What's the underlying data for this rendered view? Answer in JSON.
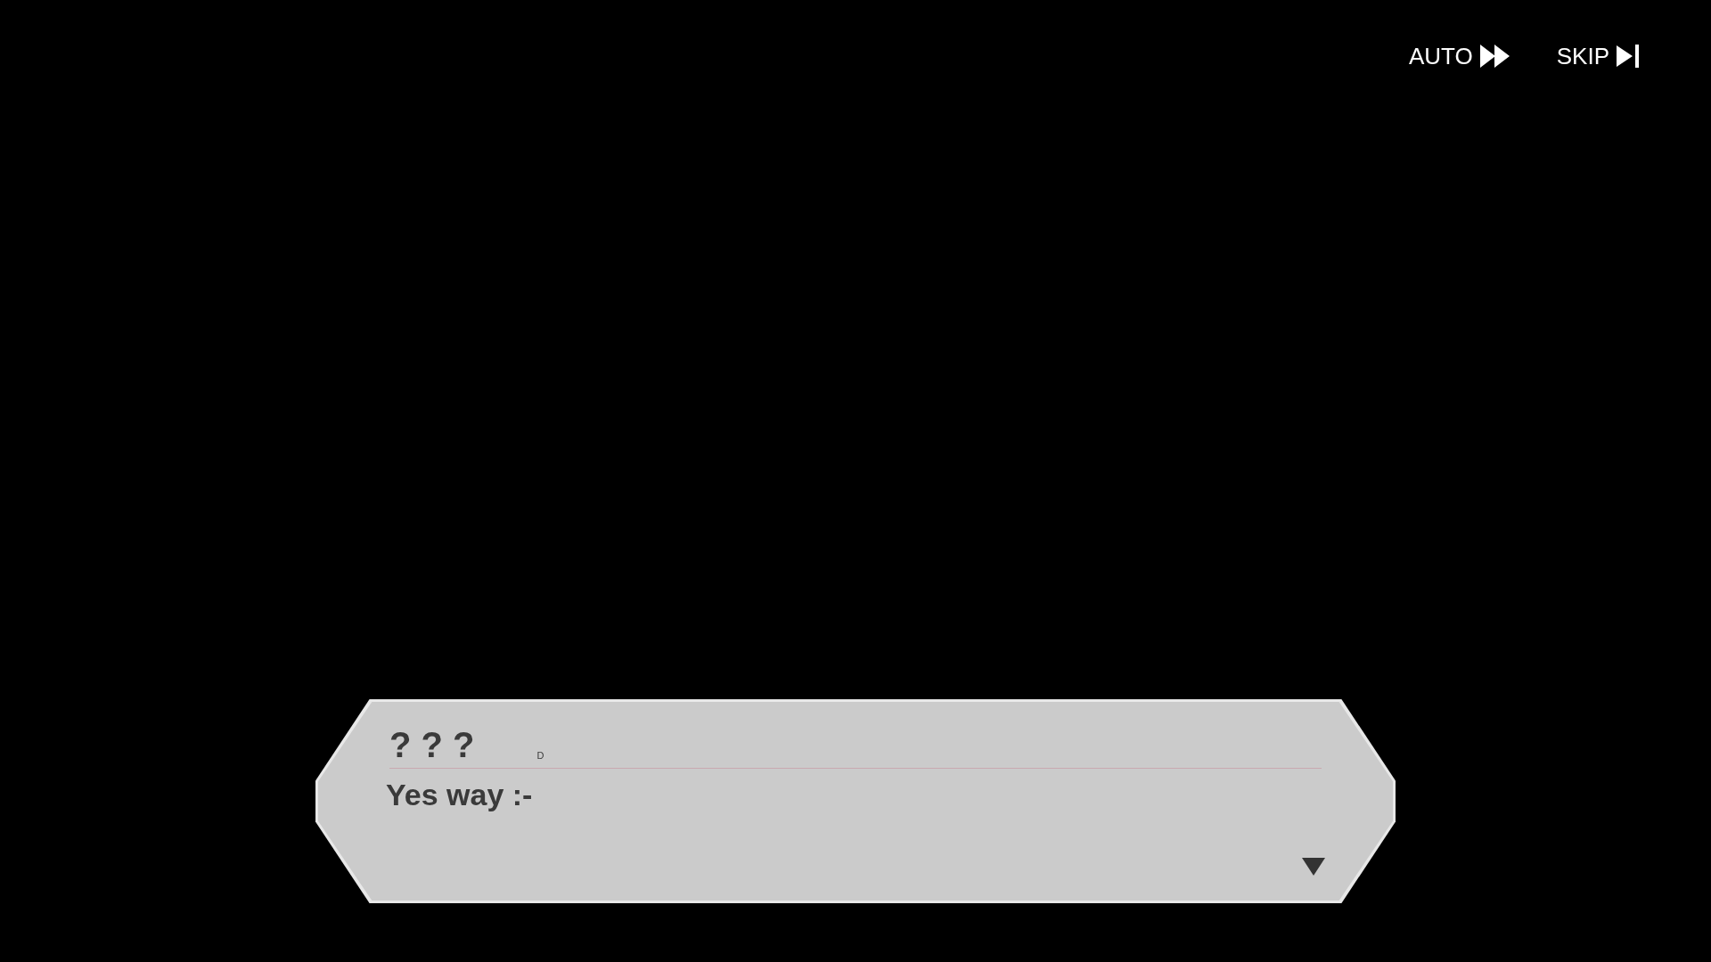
{
  "controls": [
    {
      "kind": "auto",
      "label": "AUTO"
    },
    {
      "kind": "skip",
      "label": "SKIP"
    }
  ],
  "dialogue": {
    "speaker": "? ? ?",
    "speaker_tag": "D",
    "text": "Yes way :-"
  }
}
